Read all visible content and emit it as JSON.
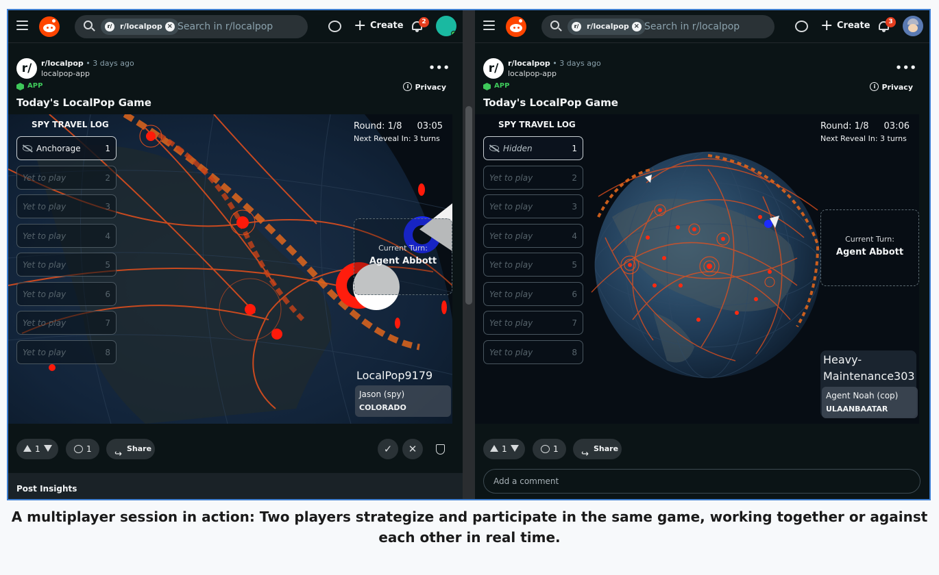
{
  "left": {
    "search": {
      "chip": "r/localpop",
      "placeholder": "Search in r/localpop"
    },
    "header": {
      "create": "Create",
      "notifications": "2"
    },
    "post": {
      "subreddit": "r/localpop",
      "time": "• 3 days ago",
      "user": "localpop-app",
      "tag": "APP",
      "privacy": "Privacy",
      "title": "Today's LocalPop Game"
    },
    "game": {
      "log_title": "SPY TRAVEL LOG",
      "log": [
        {
          "label": "Anchorage",
          "num": "1"
        },
        {
          "label": "Yet to play",
          "num": "2"
        },
        {
          "label": "Yet to play",
          "num": "3"
        },
        {
          "label": "Yet to play",
          "num": "4"
        },
        {
          "label": "Yet to play",
          "num": "5"
        },
        {
          "label": "Yet to play",
          "num": "6"
        },
        {
          "label": "Yet to play",
          "num": "7"
        },
        {
          "label": "Yet to play",
          "num": "8"
        }
      ],
      "round": "Round: 1/8",
      "timer": "03:05",
      "reveal": "Next Reveal In: 3 turns",
      "turn_label": "Current Turn:",
      "turn_name": "Agent Abbott",
      "player_name": "LocalPop9179",
      "player_role": "Jason (spy)",
      "player_location": "COLORADO"
    },
    "actions": {
      "votes": "1",
      "comments": "1",
      "share": "Share"
    },
    "insights": "Post Insights"
  },
  "right": {
    "search": {
      "chip": "r/localpop",
      "placeholder": "Search in r/localpop"
    },
    "header": {
      "create": "Create",
      "notifications": "3"
    },
    "post": {
      "subreddit": "r/localpop",
      "time": "• 3 days ago",
      "user": "localpop-app",
      "tag": "APP",
      "privacy": "Privacy",
      "title": "Today's LocalPop Game"
    },
    "game": {
      "log_title": "SPY TRAVEL LOG",
      "log": [
        {
          "label": "Hidden",
          "num": "1"
        },
        {
          "label": "Yet to play",
          "num": "2"
        },
        {
          "label": "Yet to play",
          "num": "3"
        },
        {
          "label": "Yet to play",
          "num": "4"
        },
        {
          "label": "Yet to play",
          "num": "5"
        },
        {
          "label": "Yet to play",
          "num": "6"
        },
        {
          "label": "Yet to play",
          "num": "7"
        },
        {
          "label": "Yet to play",
          "num": "8"
        }
      ],
      "round": "Round: 1/8",
      "timer": "03:06",
      "reveal": "Next Reveal In: 3 turns",
      "turn_label": "Current Turn:",
      "turn_name": "Agent Abbott",
      "player_name": "Heavy-Maintenance303",
      "player_role": "Agent Noah (cop)",
      "player_location": "ULAANBAATAR"
    },
    "actions": {
      "votes": "1",
      "comments": "1",
      "share": "Share"
    },
    "comment_placeholder": "Add a comment"
  },
  "caption": "A multiplayer session in action: Two players strategize and participate in the same game, working together or against each other in real time.",
  "colors": {
    "accent": "#ff4500",
    "frame": "#3f7fd1",
    "bg": "#0b1416",
    "route": "#e8501c"
  }
}
